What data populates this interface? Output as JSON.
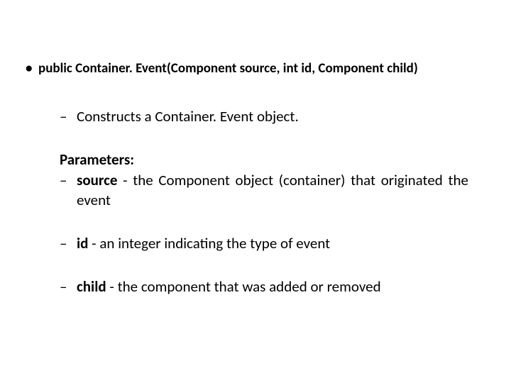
{
  "signature": "public Container. Event(Component source, int id, Component child)",
  "description": "Constructs a Container. Event object.",
  "parameters_label": "Parameters:",
  "params": {
    "source": {
      "name": "source",
      "desc": " - the Component object (container) that originated the event"
    },
    "id": {
      "name": "id",
      "desc": " - an integer indicating the type of event"
    },
    "child": {
      "name": "child",
      "desc": " - the component that was added or removed"
    }
  }
}
